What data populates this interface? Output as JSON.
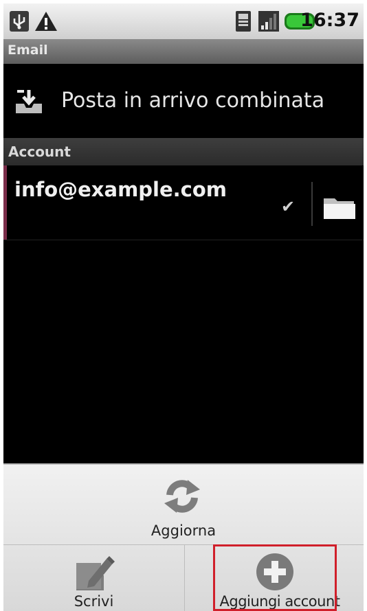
{
  "status_bar": {
    "time": "16:37",
    "icons": [
      "usb-icon",
      "warning-icon",
      "sim-icon",
      "signal-icon",
      "battery-icon"
    ],
    "battery_color": "#2db52d"
  },
  "title_bar": {
    "title": "Email"
  },
  "combined_inbox": {
    "icon": "inbox-icon",
    "label": "Posta in arrivo combinata"
  },
  "accounts_section": {
    "header": "Account",
    "accounts": [
      {
        "email": "info@example.com",
        "check_mark": "✔",
        "folder_icon": "folder-icon",
        "accent_color": "#7a2d4a"
      }
    ]
  },
  "menu": {
    "refresh_label": "Aggiorna",
    "compose_label": "Scrivi",
    "add_account_label": "Aggiungi account",
    "highlight_color": "#d01f2a"
  }
}
